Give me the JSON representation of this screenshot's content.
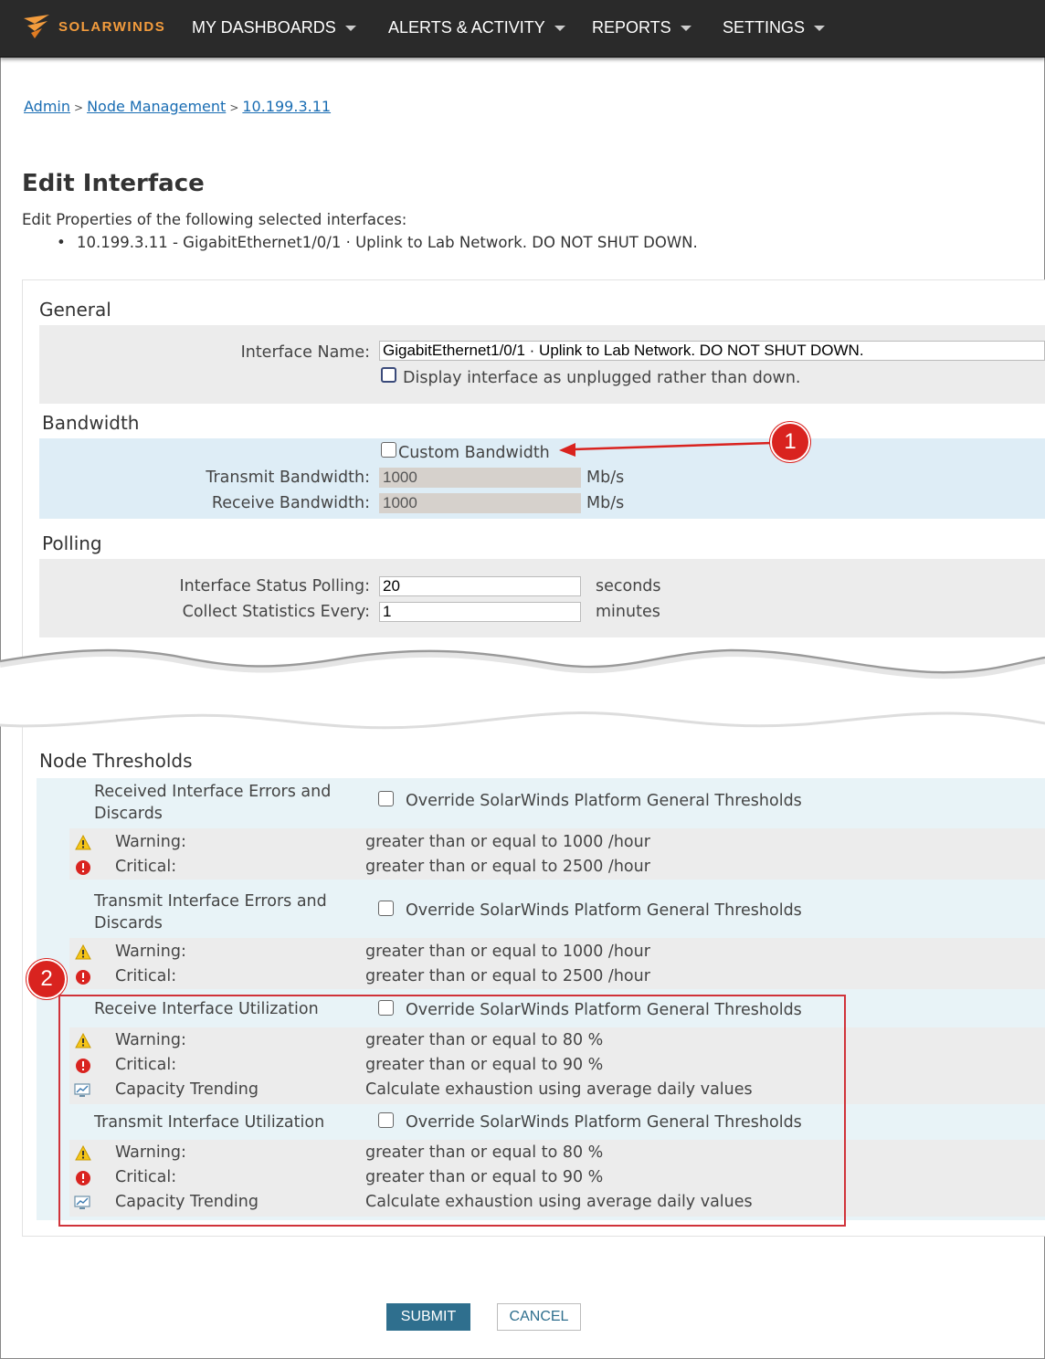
{
  "nav": {
    "brand": "SOLARWINDS",
    "items": [
      "MY DASHBOARDS",
      "ALERTS & ACTIVITY",
      "REPORTS",
      "SETTINGS"
    ],
    "brand_color": "#f39c3d",
    "bar_color": "#2a2a2a"
  },
  "breadcrumb": [
    "Admin",
    "Node Management",
    "10.199.3.11"
  ],
  "page": {
    "title": "Edit Interface",
    "intro": "Edit Properties of the following selected interfaces:",
    "selected_interface": "10.199.3.11 - GigabitEthernet1/0/1 · Uplink to Lab Network. DO NOT SHUT DOWN."
  },
  "general": {
    "heading": "General",
    "interface_name_label": "Interface Name:",
    "interface_name_value": "GigabitEthernet1/0/1 · Uplink to Lab Network. DO NOT SHUT DOWN.",
    "unplugged_label": "Display interface as unplugged rather than down."
  },
  "bandwidth": {
    "heading": "Bandwidth",
    "custom_label": "Custom Bandwidth",
    "transmit_label": "Transmit Bandwidth:",
    "transmit_value": "1000",
    "receive_label": "Receive Bandwidth:",
    "receive_value": "1000",
    "unit": "Mb/s"
  },
  "polling": {
    "heading": "Polling",
    "status_label": "Interface Status Polling:",
    "status_value": "20",
    "status_unit": "seconds",
    "stats_label": "Collect Statistics Every:",
    "stats_value": "1",
    "stats_unit": "minutes"
  },
  "thresholds": {
    "heading": "Node Thresholds",
    "override_label": "Override SolarWinds Platform General Thresholds",
    "groups": [
      {
        "title": "Received Interface Errors and Discards",
        "rows": [
          {
            "icon": "warning-icon",
            "label": "Warning:",
            "value": "greater than or equal to 1000 /hour"
          },
          {
            "icon": "critical-icon",
            "label": "Critical:",
            "value": "greater than or equal to 2500 /hour"
          }
        ]
      },
      {
        "title": "Transmit Interface Errors and Discards",
        "rows": [
          {
            "icon": "warning-icon",
            "label": "Warning:",
            "value": "greater than or equal to 1000 /hour"
          },
          {
            "icon": "critical-icon",
            "label": "Critical:",
            "value": "greater than or equal to 2500 /hour"
          }
        ]
      },
      {
        "title": "Receive Interface Utilization",
        "rows": [
          {
            "icon": "warning-icon",
            "label": "Warning:",
            "value": "greater than or equal to 80 %"
          },
          {
            "icon": "critical-icon",
            "label": "Critical:",
            "value": "greater than or equal to 90 %"
          },
          {
            "icon": "capacity-trending-icon",
            "label": "Capacity Trending",
            "value": "Calculate exhaustion using average daily values"
          }
        ]
      },
      {
        "title": "Transmit Interface Utilization",
        "rows": [
          {
            "icon": "warning-icon",
            "label": "Warning:",
            "value": "greater than or equal to 80 %"
          },
          {
            "icon": "critical-icon",
            "label": "Critical:",
            "value": "greater than or equal to 90 %"
          },
          {
            "icon": "capacity-trending-icon",
            "label": "Capacity Trending",
            "value": "Calculate exhaustion using average daily values"
          }
        ]
      }
    ]
  },
  "callouts": [
    "1",
    "2"
  ],
  "buttons": {
    "submit": "SUBMIT",
    "cancel": "CANCEL"
  }
}
